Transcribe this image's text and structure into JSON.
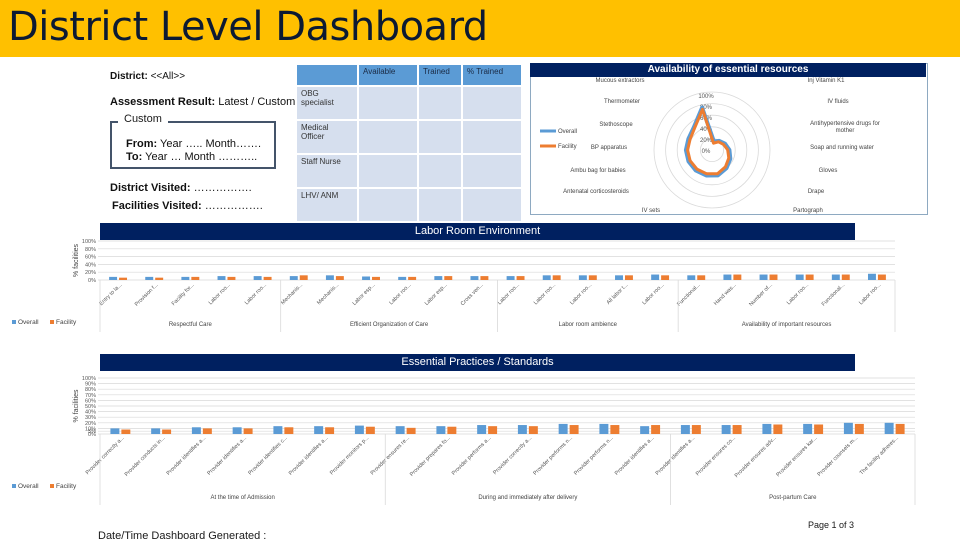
{
  "header": {
    "title": "District Level Dashboard"
  },
  "filters": {
    "district_label": "District:",
    "district_value": "<<All>>",
    "assessment_label": "Assessment Result:",
    "assessment_value": "Latest / Custom",
    "custom_legend": "Custom",
    "from_label": "From:",
    "from_value": "Year ….. Month…….",
    "to_label": "To:",
    "to_value": "Year … Month ………..",
    "district_visited_label": "District Visited:",
    "district_visited_value": "…………….",
    "facilities_visited_label": "Facilities Visited:",
    "facilities_visited_value": "……………."
  },
  "staff_table": {
    "columns": [
      "",
      "Available",
      "Trained",
      "% Trained"
    ],
    "rows": [
      {
        "role": "OBG specialist",
        "available": "",
        "trained": "",
        "pct_trained": ""
      },
      {
        "role": "Medical Officer",
        "available": "",
        "trained": "",
        "pct_trained": ""
      },
      {
        "role": "Staff Nurse",
        "available": "",
        "trained": "",
        "pct_trained": ""
      },
      {
        "role": "LHV/ ANM",
        "available": "",
        "trained": "",
        "pct_trained": ""
      }
    ]
  },
  "colors": {
    "overall": "#5B9BD5",
    "facility": "#ED7D31",
    "section": "#002060",
    "header": "#FFC000"
  },
  "chart_data": [
    {
      "type": "radar",
      "title": "Availability of essential resources",
      "axes": [
        "Inj Vitamin K1",
        "IV fluids",
        "Antihypertensive drugs for mother",
        "Soap and running water",
        "Gloves",
        "Drape",
        "Partograph",
        "IV sets",
        "Antenatal corticosteroids",
        "Ambu bag for babies",
        "BP apparatus",
        "Stethoscope",
        "Thermometer",
        "Mucous extractors"
      ],
      "radial_ticks": [
        "0%",
        "20%",
        "40%",
        "60%",
        "80%",
        "100%"
      ],
      "rlim": [
        0,
        100
      ],
      "legend": [
        "Overall",
        "Facility"
      ],
      "legend_position": "left",
      "series": [
        {
          "name": "Overall",
          "values": [
            15,
            20,
            25,
            30,
            35,
            40,
            45,
            45,
            45,
            45,
            45,
            45,
            50,
            75
          ]
        },
        {
          "name": "Facility",
          "values": [
            12,
            18,
            22,
            27,
            32,
            37,
            42,
            42,
            42,
            42,
            42,
            42,
            48,
            72
          ]
        }
      ]
    },
    {
      "type": "bar",
      "title": "Labor Room Environment",
      "ylabel": "% facilities",
      "ylim": [
        0,
        100
      ],
      "yticks": [
        "0%",
        "20%",
        "40%",
        "60%",
        "80%",
        "100%"
      ],
      "groups": [
        {
          "name": "Respectful Care",
          "count": 5
        },
        {
          "name": "Efficient Organization of Care",
          "count": 6
        },
        {
          "name": "Labor room ambience",
          "count": 5
        },
        {
          "name": "Availability of important resources",
          "count": 6
        }
      ],
      "categories": [
        "Entry to la...",
        "Provision f...",
        "Facility for...",
        "Labor roo...",
        "Labor roo...",
        "Mechanis...",
        "Mechanis...",
        "Labor esp...",
        "Labor roo...",
        "Labor esp...",
        "Cross ven...",
        "Labor roo...",
        "Labor roo...",
        "Labor roo...",
        "All labor t...",
        "Labor roo...",
        "Functional...",
        "Hand was...",
        "Number of...",
        "Labor roo...",
        "Functional...",
        "Labor roo..."
      ],
      "legend": [
        "Overall",
        "Facility"
      ],
      "legend_position": "bottom-left",
      "series": [
        {
          "name": "Overall",
          "values": [
            8,
            8,
            8,
            10,
            10,
            10,
            12,
            9,
            8,
            10,
            10,
            10,
            12,
            12,
            12,
            14,
            12,
            14,
            14,
            14,
            14,
            16
          ]
        },
        {
          "name": "Facility",
          "values": [
            6,
            6,
            8,
            8,
            8,
            12,
            10,
            8,
            8,
            10,
            10,
            10,
            12,
            12,
            12,
            12,
            12,
            14,
            14,
            14,
            14,
            14
          ]
        }
      ]
    },
    {
      "type": "bar",
      "title": "Essential Practices / Standards",
      "ylabel": "% facilities",
      "ylim": [
        0,
        100
      ],
      "yticks": [
        "0%",
        "5%",
        "10%",
        "20%",
        "30%",
        "40%",
        "50%",
        "60%",
        "70%",
        "80%",
        "90%",
        "100%"
      ],
      "groups": [
        {
          "name": "At the time of Admission",
          "count": 7
        },
        {
          "name": "During and immediately after delivery",
          "count": 7
        },
        {
          "name": "Post-partum Care",
          "count": 6
        }
      ],
      "categories": [
        "Provider correctly a...",
        "Provider conducts in...",
        "Provider identifies a...",
        "Provider identifies a...",
        "Provider identifies c...",
        "Provider identifies a...",
        "Provider monitors p...",
        "Provider ensures re...",
        "Provider prepares fo...",
        "Provider performs a...",
        "Provider correctly a...",
        "Provider performs n...",
        "Provider performs n...",
        "Provider identifies a...",
        "Provider identifies a...",
        "Provider ensures co...",
        "Provider ensures adv...",
        "Provider ensures kar...",
        "Provider counsels m...",
        "The facility adheres..."
      ],
      "legend": [
        "Overall",
        "Facility"
      ],
      "legend_position": "bottom-left",
      "series": [
        {
          "name": "Overall",
          "values": [
            10,
            10,
            12,
            12,
            14,
            14,
            15,
            14,
            14,
            16,
            16,
            18,
            18,
            14,
            16,
            16,
            18,
            18,
            20,
            20
          ]
        },
        {
          "name": "Facility",
          "values": [
            8,
            8,
            10,
            10,
            12,
            12,
            13,
            11,
            13,
            14,
            14,
            16,
            16,
            16,
            16,
            16,
            17,
            17,
            18,
            18
          ]
        }
      ]
    }
  ],
  "footer": {
    "date_label": "Date/Time Dashboard Generated :",
    "page": "Page 1 of 3"
  }
}
